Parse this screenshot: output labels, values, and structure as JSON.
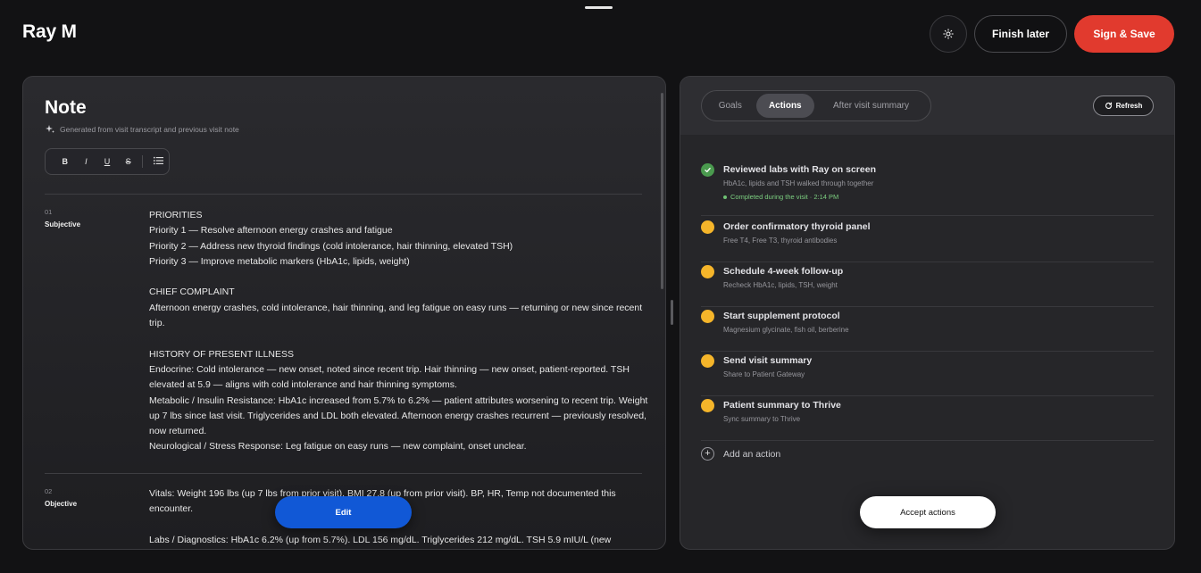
{
  "header": {
    "patient_name": "Ray M",
    "finish_later_label": "Finish later",
    "sign_save_label": "Sign & Save"
  },
  "note": {
    "title": "Note",
    "subtitle": "Generated from visit transcript and previous visit note",
    "toolbar": {
      "bold": "B",
      "italic": "I",
      "underline": "U",
      "strike": "S"
    },
    "sections": [
      {
        "number": "01",
        "name": "Subjective",
        "lines": [
          "PRIORITIES",
          "Priority 1 — Resolve afternoon energy crashes and fatigue",
          "Priority 2 — Address new thyroid findings (cold intolerance, hair thinning, elevated TSH)",
          "Priority 3 — Improve metabolic markers (HbA1c, lipids, weight)",
          "",
          "CHIEF COMPLAINT",
          "Afternoon energy crashes, cold intolerance, hair thinning, and leg fatigue on easy runs — returning or new since recent trip.",
          "",
          "HISTORY OF PRESENT ILLNESS",
          "Endocrine: Cold intolerance — new onset, noted since recent trip. Hair thinning — new onset, patient-reported. TSH elevated at 5.9 — aligns with cold intolerance and hair thinning symptoms.",
          "Metabolic / Insulin Resistance: HbA1c increased from 5.7% to 6.2% — patient attributes worsening to recent trip. Weight up 7 lbs since last visit. Triglycerides and LDL both elevated. Afternoon energy crashes recurrent — previously resolved, now returned.",
          "Neurological / Stress Response: Leg fatigue on easy runs — new complaint, onset unclear."
        ]
      },
      {
        "number": "02",
        "name": "Objective",
        "lines": [
          "Vitals: Weight 196 lbs (up 7 lbs from prior visit). BMI 27.8 (up from prior visit). BP, HR, Temp not documented this encounter.",
          "",
          "Labs / Diagnostics: HbA1c 6.2% (up from 5.7%). LDL 156 mg/dL. Triglycerides 212 mg/dL. TSH 5.9 mIU/L (new"
        ]
      }
    ],
    "edit_label": "Edit"
  },
  "actions": {
    "tabs": [
      {
        "label": "Goals",
        "active": false
      },
      {
        "label": "Actions",
        "active": true
      },
      {
        "label": "After visit summary",
        "active": false
      }
    ],
    "refresh_label": "Refresh",
    "items": [
      {
        "title": "Reviewed labs with Ray on screen",
        "subtitle": "HbA1c, lipids and TSH walked through together",
        "status": "done",
        "note": "Completed during the visit · 2:14 PM"
      },
      {
        "title": "Order confirmatory thyroid panel",
        "subtitle": "Free T4, Free T3, thyroid antibodies",
        "status": "pending"
      },
      {
        "title": "Schedule 4-week follow-up",
        "subtitle": "Recheck HbA1c, lipids, TSH, weight",
        "status": "pending"
      },
      {
        "title": "Start supplement protocol",
        "subtitle": "Magnesium glycinate, fish oil, berberine",
        "status": "pending"
      },
      {
        "title": "Send visit summary",
        "subtitle": "Share to Patient Gateway",
        "status": "pending"
      },
      {
        "title": "Patient summary to Thrive",
        "subtitle": "Sync summary to Thrive",
        "status": "pending"
      }
    ],
    "add_action_label": "Add an action",
    "accept_label": "Accept actions"
  },
  "colors": {
    "background": "#121214",
    "accent_red": "#e13a2e",
    "accent_blue": "#1158d6",
    "pending": "#f5b52a",
    "done": "#4a9a4e"
  }
}
